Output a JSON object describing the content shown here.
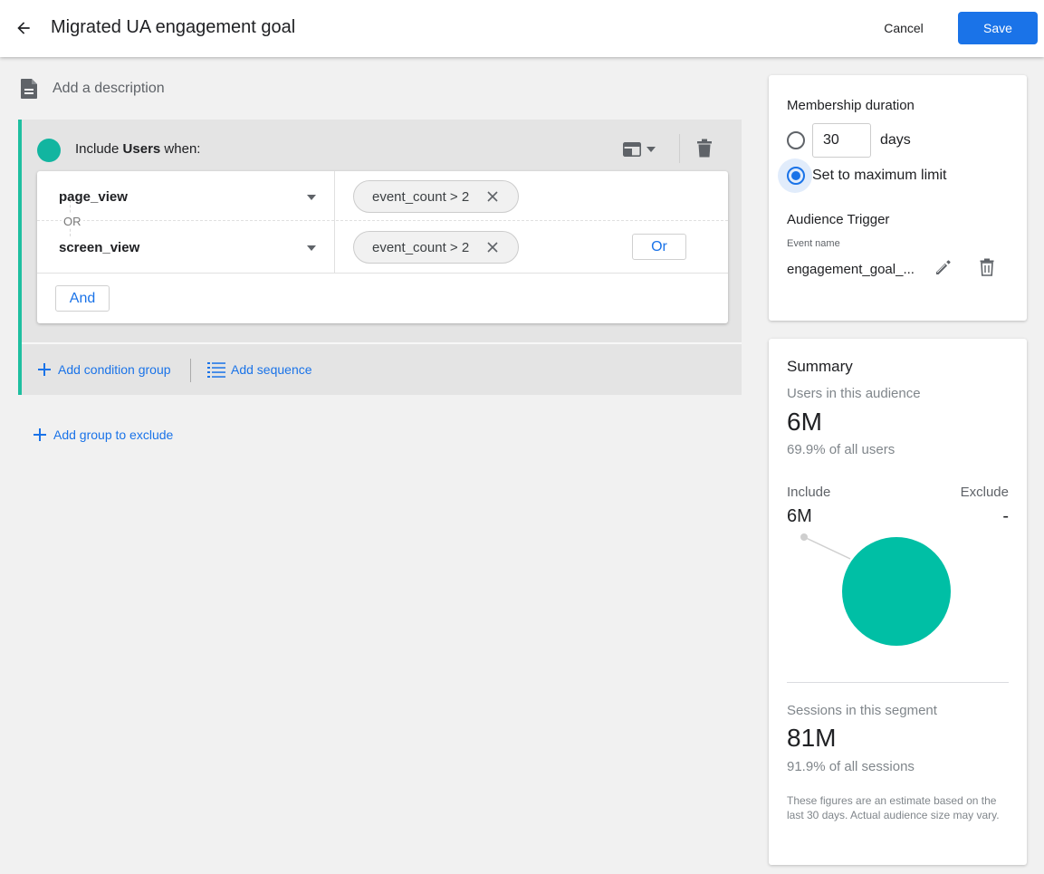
{
  "header": {
    "title": "Migrated UA engagement goal",
    "cancel_label": "Cancel",
    "save_label": "Save"
  },
  "description": {
    "placeholder": "Add a description"
  },
  "condition_group": {
    "prefix": "Include",
    "scope": "Users",
    "suffix": "when:",
    "accent_color": "#1ebfa0",
    "conditions": [
      {
        "event": "page_view",
        "param_chip": "event_count > 2"
      },
      {
        "event": "screen_view",
        "param_chip": "event_count > 2"
      }
    ],
    "or_separator": "OR",
    "or_button": "Or",
    "and_button": "And",
    "add_condition_group": "Add condition group",
    "add_sequence": "Add sequence"
  },
  "exclude": {
    "add_label": "Add group to exclude"
  },
  "membership": {
    "title": "Membership duration",
    "days_value": "30",
    "days_label": "days",
    "max_label": "Set to maximum limit",
    "selected_option": "max",
    "trigger_title": "Audience Trigger",
    "event_caption": "Event name",
    "event_value": "engagement_goal_..."
  },
  "summary": {
    "title": "Summary",
    "users_label": "Users in this audience",
    "users_value": "6M",
    "users_pct": "69.9% of all users",
    "include_label": "Include",
    "exclude_label": "Exclude",
    "include_value": "6M",
    "exclude_value": "-",
    "sessions_label": "Sessions in this segment",
    "sessions_value": "81M",
    "sessions_pct": "91.9% of all sessions",
    "note": "These figures are an estimate based on the last 30 days. Actual audience size may vary.",
    "pie_color": "#00bfa5"
  },
  "colors": {
    "primary": "#1a73e8",
    "accent": "#1ebfa0"
  }
}
